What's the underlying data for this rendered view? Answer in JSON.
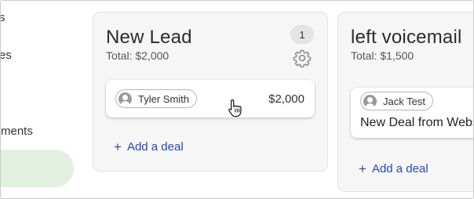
{
  "sidebar": {
    "items": [
      {
        "label": "s"
      },
      {
        "label": "es"
      },
      {
        "label": "ments"
      }
    ]
  },
  "columns": [
    {
      "title": "New Lead",
      "total": "Total: $2,000",
      "count": "1",
      "cards": [
        {
          "owner": "Tyler Smith",
          "amount": "$2,000"
        }
      ],
      "add_label": "Add a deal"
    },
    {
      "title": "left voicemail",
      "total": "Total: $1,500",
      "cards": [
        {
          "owner": "Jack Test",
          "deal_title": "New Deal from Website"
        }
      ],
      "add_label": "Add a deal"
    }
  ],
  "colors": {
    "accent": "#2a45b8",
    "active_nav": "#e2f0df",
    "column_bg": "#f6f6f6"
  },
  "icons": {
    "settings": "gear-icon",
    "avatar": "user-avatar-icon",
    "add": "plus-icon",
    "cursor": "hand-pointer-cursor"
  }
}
